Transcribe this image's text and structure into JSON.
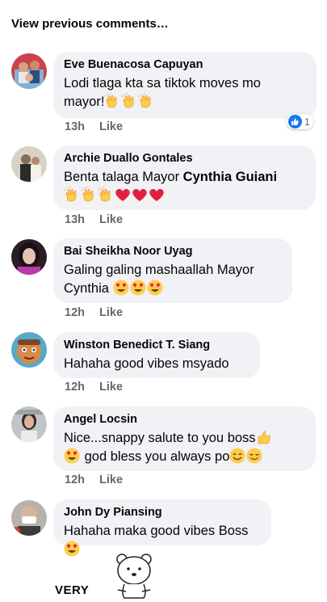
{
  "view_previous": "View previous comments…",
  "like_label": "Like",
  "reaction": {
    "icon": "thumbs-up-icon",
    "count": "1",
    "color": "#1877f2"
  },
  "comments": [
    {
      "author": "Eve Buenacosa Capuyan",
      "line1": "Lodi tlaga kta sa tiktok moves mo",
      "line2": "mayor!",
      "emojis": [
        "clap",
        "clap",
        "clap"
      ],
      "time": "13h"
    },
    {
      "author": "Archie Duallo Gontales",
      "line1_pre": "Benta talaga Mayor ",
      "mention": "Cynthia Guiani",
      "emojis": [
        "clap",
        "clap",
        "clap",
        "heart",
        "heart",
        "heart"
      ],
      "time": "13h"
    },
    {
      "author": "Bai Sheikha Noor Uyag",
      "line1": "Galing galing mashaallah Mayor",
      "line2": "Cynthia",
      "emojis": [
        "heart-eyes",
        "heart-eyes",
        "heart-eyes"
      ],
      "time": "12h"
    },
    {
      "author": "Winston Benedict T. Siang",
      "line1": "Hahaha  good vibes msyado",
      "time": "12h"
    },
    {
      "author": "Angel Locsin",
      "line1": "Nice...snappy  salute  to you boss",
      "line2": "god bless you always po",
      "emojis": [
        "thumbs-up",
        "heart-eyes",
        "smile",
        "relieved"
      ],
      "time": "12h"
    },
    {
      "author": "John Dy Piansing",
      "line1": "Hahaha maka good vibes Boss",
      "emojis": [
        "heart-eyes"
      ]
    }
  ],
  "sticker": {
    "text": "VERY",
    "icon": "bear-sticker-icon"
  },
  "colors": {
    "bubble": "#f0f2f5",
    "meta": "#65676b",
    "text": "#050505",
    "heart": "#e41e3f",
    "emoji_yellow": "#ffcc4d"
  }
}
